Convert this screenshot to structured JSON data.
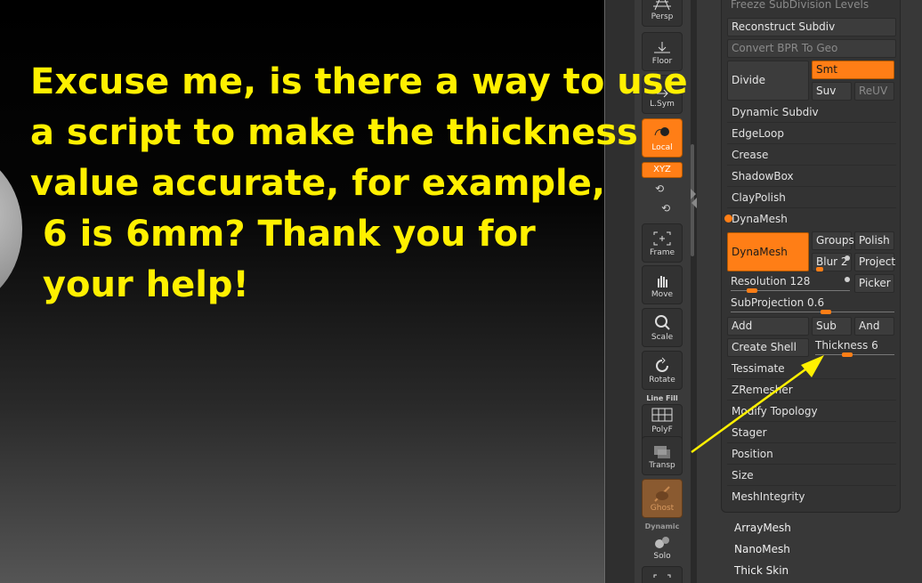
{
  "overlay": {
    "text": "Excuse me, is there a way to use\na script to make the thickness\nvalue accurate, for example,\n 6 is 6mm? Thank you for\n your help!",
    "color": "#fff000"
  },
  "shelf": {
    "persp": "Persp",
    "floor": "Floor",
    "lsym": "L.Sym",
    "local": "Local",
    "xyz": "XYZ",
    "frame": "Frame",
    "move": "Move",
    "scale": "Scale",
    "rotate": "Rotate",
    "line_fill": "Line Fill",
    "polyf": "PolyF",
    "transp": "Transp",
    "ghost": "Ghost",
    "dynamic": "Dynamic",
    "solo": "Solo",
    "xyz_small": "X Y Z"
  },
  "panel": {
    "freeze_subdiv": "Freeze SubDivision Levels",
    "reconstruct_subdiv": "Reconstruct Subdiv",
    "convert_bpr": "Convert BPR To Geo",
    "divide": "Divide",
    "smt": "Smt",
    "suv": "Suv",
    "reuv": "ReUV",
    "rows_top": [
      "Dynamic Subdiv",
      "EdgeLoop",
      "Crease",
      "ShadowBox",
      "ClayPolish"
    ],
    "dynamesh_header": "DynaMesh",
    "dynamesh_button": "DynaMesh",
    "groups": "Groups",
    "polish": "Polish",
    "blur": "Blur 2",
    "project": "Project",
    "resolution": "Resolution 128",
    "picker": "Picker",
    "subprojection": "SubProjection 0.6",
    "add": "Add",
    "sub": "Sub",
    "and": "And",
    "create_shell": "Create Shell",
    "thickness": "Thickness 6",
    "rows_bottom": [
      "Tessimate",
      "ZRemesher",
      "Modify Topology",
      "Stager",
      "Position",
      "Size",
      "MeshIntegrity"
    ]
  },
  "below": [
    "ArrayMesh",
    "NanoMesh",
    "Thick Skin"
  ],
  "colors": {
    "accent": "#ff7e16",
    "annotation": "#fff000"
  }
}
